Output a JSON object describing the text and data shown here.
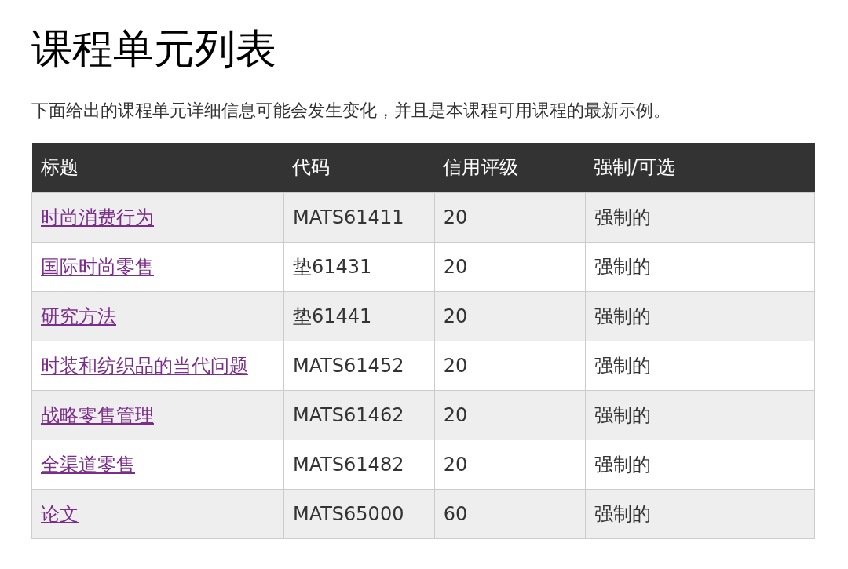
{
  "title": "课程单元列表",
  "intro": "下面给出的课程单元详细信息可能会发生变化，并且是本课程可用课程的最新示例。",
  "table": {
    "columns": [
      "标题",
      "代码",
      "信用评级",
      "强制/可选"
    ],
    "rows": [
      {
        "title": "时尚消费行为",
        "code": "MATS61411",
        "credits": "20",
        "status": "强制的"
      },
      {
        "title": "国际时尚零售",
        "code": "垫61431",
        "credits": "20",
        "status": "强制的"
      },
      {
        "title": "研究方法",
        "code": "垫61441",
        "credits": "20",
        "status": "强制的"
      },
      {
        "title": "时装和纺织品的当代问题",
        "code": "MATS61452",
        "credits": "20",
        "status": "强制的"
      },
      {
        "title": "战略零售管理",
        "code": "MATS61462",
        "credits": "20",
        "status": "强制的"
      },
      {
        "title": "全渠道零售",
        "code": "MATS61482",
        "credits": "20",
        "status": "强制的"
      },
      {
        "title": "论文",
        "code": "MATS65000",
        "credits": "60",
        "status": "强制的"
      }
    ]
  }
}
